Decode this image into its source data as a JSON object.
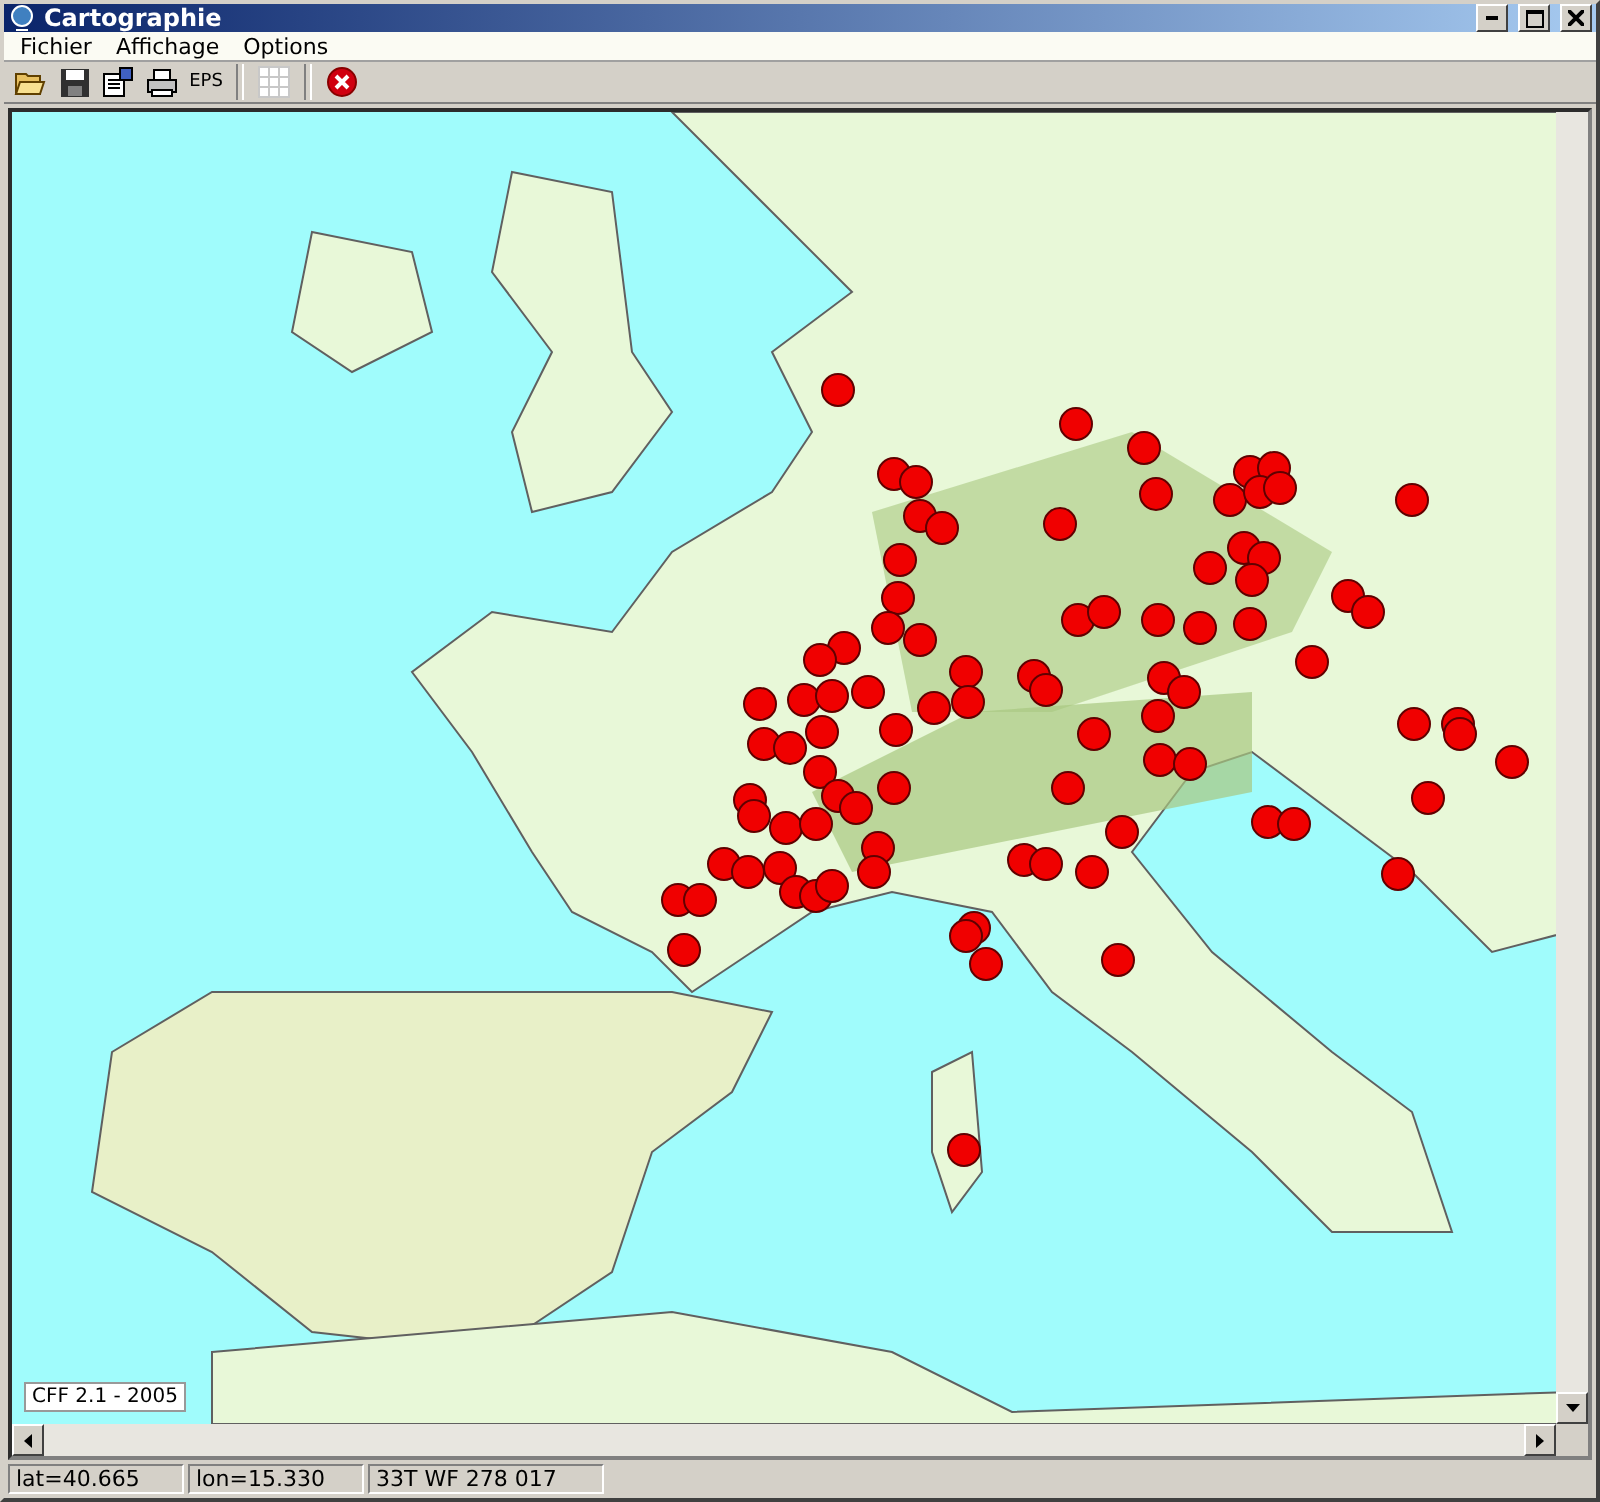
{
  "window": {
    "title": "Cartographie"
  },
  "menu": [
    "Fichier",
    "Affichage",
    "Options"
  ],
  "toolbar": [
    {
      "kind": "open"
    },
    {
      "kind": "save"
    },
    {
      "kind": "properties"
    },
    {
      "kind": "print"
    },
    {
      "kind": "text",
      "label": "EPS"
    },
    {
      "kind": "separator"
    },
    {
      "kind": "grid"
    },
    {
      "kind": "separator"
    },
    {
      "kind": "stop"
    }
  ],
  "map": {
    "credit": "CFF 2.1 - 2005"
  },
  "status_bar": [
    "lat=40.665",
    "lon=15.330",
    "33T WF 278 017"
  ]
}
